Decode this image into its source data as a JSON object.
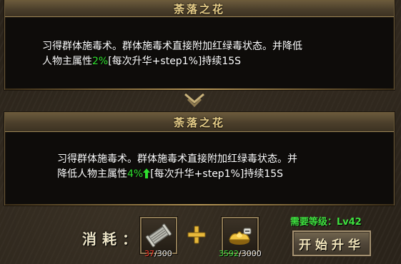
{
  "panels": [
    {
      "title": "荼落之花",
      "desc_lines": {
        "line1": "习得群体施毒术。群体施毒术直接附加红绿毒状态。并降低",
        "line2_prefix": "人物主属性",
        "value": "2%",
        "line2_suffix": "[每次升华+step1%]持续15S"
      }
    },
    {
      "title": "荼落之花",
      "desc_lines": {
        "line1": "习得群体施毒术。群体施毒术直接附加红绿毒状态。并",
        "line2_prefix": "降低人物主属性",
        "value": "4%",
        "line2_suffix": "[每次升华+step1%]持续15S"
      }
    }
  ],
  "cost": {
    "label": "消耗：",
    "items": [
      {
        "icon": "scroll-item-icon",
        "have": "37",
        "need": "/300",
        "have_color": "#ff3a2a"
      },
      {
        "icon": "gold-ingot-icon",
        "have": "3592",
        "need": "/3000",
        "have_color": "#3ee03e"
      }
    ]
  },
  "requirement": "需要等级：Lv42",
  "start_button": "开始升华",
  "colors": {
    "accent_gold": "#e8cf8a",
    "value_green": "#2fe02f",
    "insufficient_red": "#ff3a2a"
  },
  "icons": {
    "divider": "double-chevron-down-icon",
    "plus": "plus-icon",
    "up": "up-arrow-icon"
  }
}
